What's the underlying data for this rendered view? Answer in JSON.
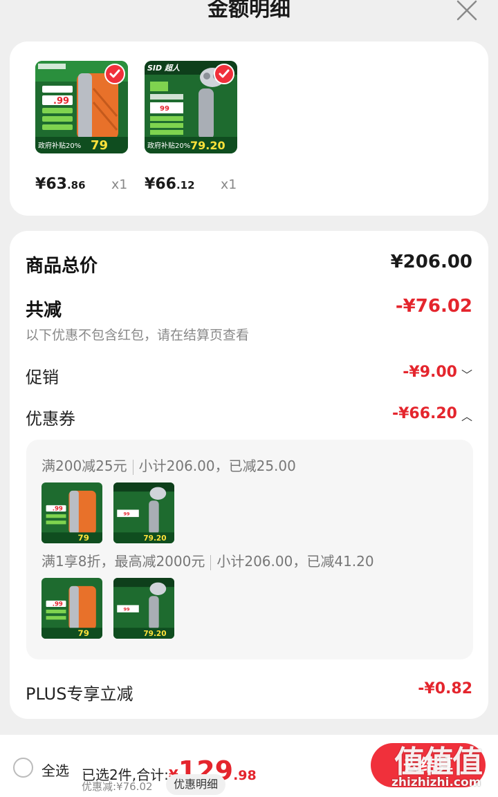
{
  "header": {
    "title": "金额明细",
    "close_icon": "close-icon"
  },
  "products": [
    {
      "image_desc": "orange-shaver-product-image",
      "price_symbol": "¥",
      "price_int": "63",
      "price_dec": ".86",
      "qty": "x1"
    },
    {
      "image_desc": "silver-shaver-product-image",
      "price_symbol": "¥",
      "price_int": "66",
      "price_dec": ".12",
      "qty": "x1"
    }
  ],
  "summary": {
    "total_label": "商品总价",
    "total_value": "¥206.00",
    "reduce_label": "共减",
    "reduce_value": "-¥76.02",
    "reduce_note": "以下优惠不包含红包，请在结算页查看",
    "promo_label": "促销",
    "promo_value": "-¥9.00",
    "coupon_label": "优惠券",
    "coupon_value": "-¥66.20",
    "plus_label": "PLUS专享立减",
    "plus_value": "-¥0.82"
  },
  "coupons": [
    {
      "title_a": "满200减25元",
      "title_b": "小计206.00，已减25.00"
    },
    {
      "title_a": "满1享8折，最高减2000元",
      "title_b": "小计206.00，已减41.20"
    }
  ],
  "bottom_bar": {
    "select_all": "全选",
    "selected_prefix": "已选2件,合计:",
    "total_symbol": "¥",
    "total_int": "129",
    "total_dec": ".98",
    "discount_text": "优惠减:¥76.02",
    "detail_button": "优惠明细",
    "checkout_button": "去结算"
  },
  "watermark": {
    "glyphs": "值值值",
    "url": "zhizhizhi.com"
  },
  "colors": {
    "accent_red": "#e4252d",
    "badge_red": "#f0303b",
    "orange_product": "#e8712a",
    "promo_green": "#22a83a",
    "gray_text": "#888888"
  }
}
